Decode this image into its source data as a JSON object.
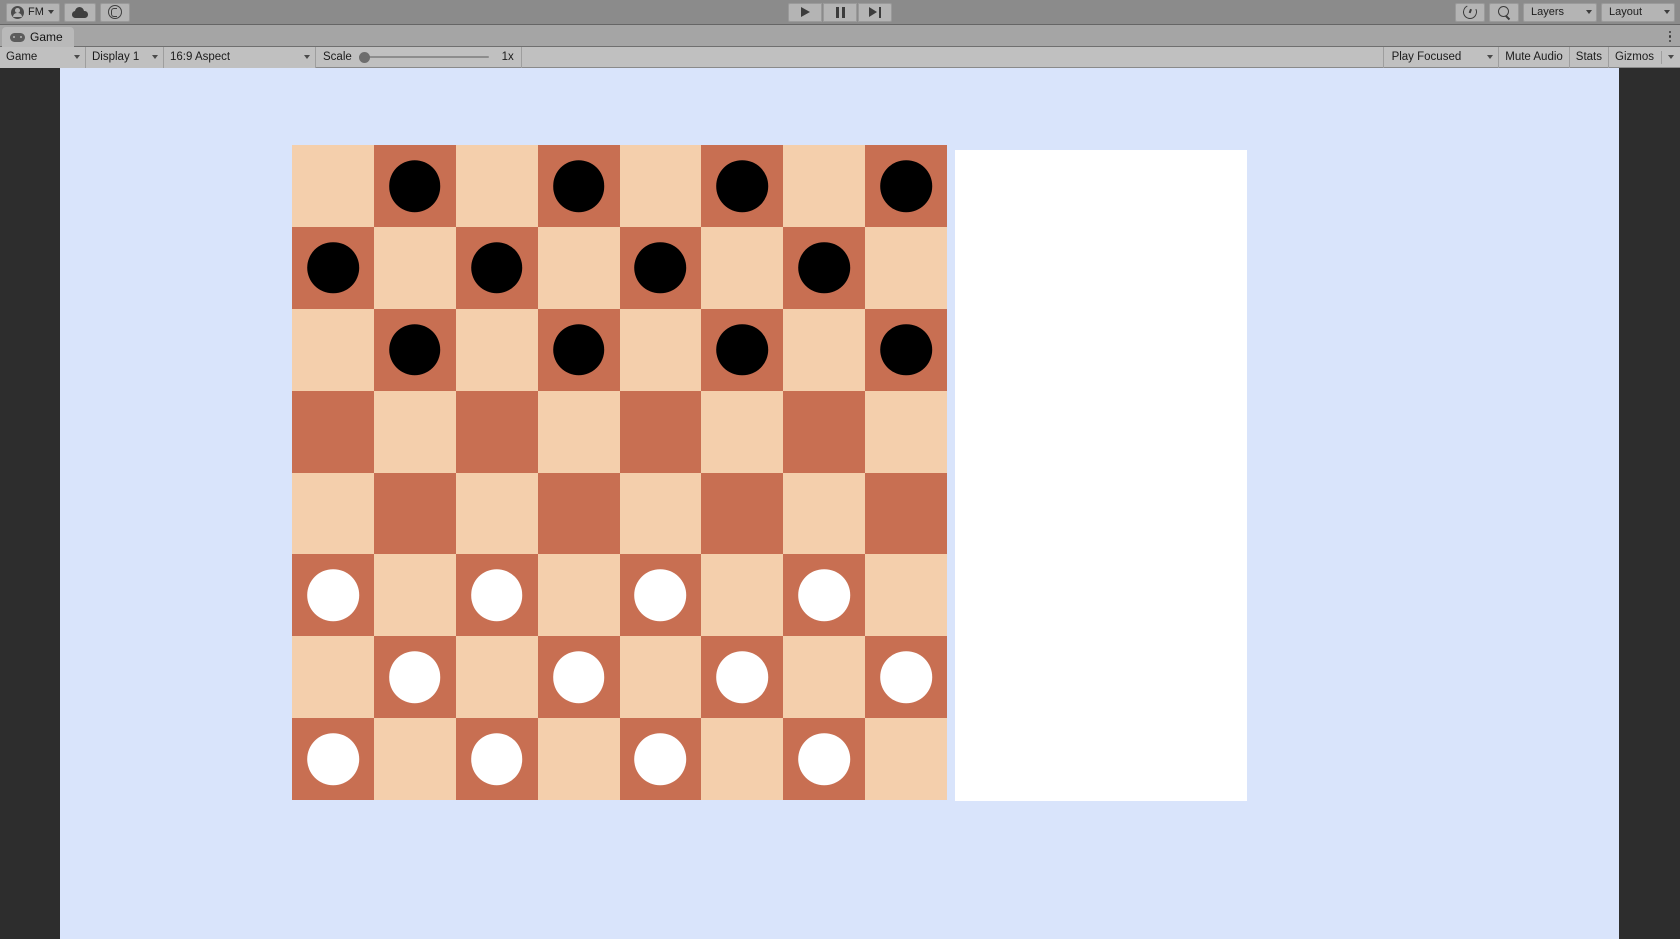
{
  "app": {
    "name": "Unity Editor",
    "view": "Game"
  },
  "toolbar": {
    "account_label": "FM",
    "account_icon": "avatar-icon",
    "cloud_icon": "cloud-icon",
    "collab_icon": "collab-icon",
    "play_icon": "play-icon",
    "pause_icon": "pause-icon",
    "step_icon": "step-icon",
    "history_icon": "history-icon",
    "search_icon": "search-icon",
    "layers_label": "Layers",
    "layout_label": "Layout"
  },
  "tab": {
    "label": "Game",
    "icon": "gamepad-icon",
    "kebab_icon": "kebab-menu-icon"
  },
  "view_bar": {
    "view_type": "Game",
    "display": "Display 1",
    "aspect": "16:9 Aspect",
    "scale_label": "Scale",
    "scale_value": "1x",
    "scale_percent": 0,
    "play_mode": "Play Focused",
    "mute_audio": "Mute Audio",
    "stats": "Stats",
    "gizmos": "Gizmos"
  },
  "colors": {
    "background": "#d9e4fb",
    "light_square": "#f4cfac",
    "dark_square": "#c86f52",
    "black_piece": "#000000",
    "white_piece": "#ffffff",
    "panel": "#ffffff",
    "editor_chrome": "#8b8b8b",
    "empty_area": "#2d2d2d"
  },
  "board": {
    "rows": 8,
    "columns": 8,
    "description": "Checkers / draughts starting position",
    "squares": [
      [
        "light",
        "dark",
        "light",
        "dark",
        "light",
        "dark",
        "light",
        "dark"
      ],
      [
        "dark",
        "light",
        "dark",
        "light",
        "dark",
        "light",
        "dark",
        "light"
      ],
      [
        "light",
        "dark",
        "light",
        "dark",
        "light",
        "dark",
        "light",
        "dark"
      ],
      [
        "dark",
        "light",
        "dark",
        "light",
        "dark",
        "light",
        "dark",
        "light"
      ],
      [
        "light",
        "dark",
        "light",
        "dark",
        "light",
        "dark",
        "light",
        "dark"
      ],
      [
        "dark",
        "light",
        "dark",
        "light",
        "dark",
        "light",
        "dark",
        "light"
      ],
      [
        "light",
        "dark",
        "light",
        "dark",
        "light",
        "dark",
        "light",
        "dark"
      ],
      [
        "dark",
        "light",
        "dark",
        "light",
        "dark",
        "light",
        "dark",
        "light"
      ]
    ],
    "pieces": [
      [
        "",
        "black",
        "",
        "black",
        "",
        "black",
        "",
        "black"
      ],
      [
        "black",
        "",
        "black",
        "",
        "black",
        "",
        "black",
        ""
      ],
      [
        "",
        "black",
        "",
        "black",
        "",
        "black",
        "",
        "black"
      ],
      [
        "",
        "",
        "",
        "",
        "",
        "",
        "",
        ""
      ],
      [
        "",
        "",
        "",
        "",
        "",
        "",
        "",
        ""
      ],
      [
        "white",
        "",
        "white",
        "",
        "white",
        "",
        "white",
        ""
      ],
      [
        "",
        "white",
        "",
        "white",
        "",
        "white",
        "",
        "white"
      ],
      [
        "white",
        "",
        "white",
        "",
        "white",
        "",
        "white",
        ""
      ]
    ],
    "black_piece_count": 12,
    "white_piece_count": 12
  }
}
